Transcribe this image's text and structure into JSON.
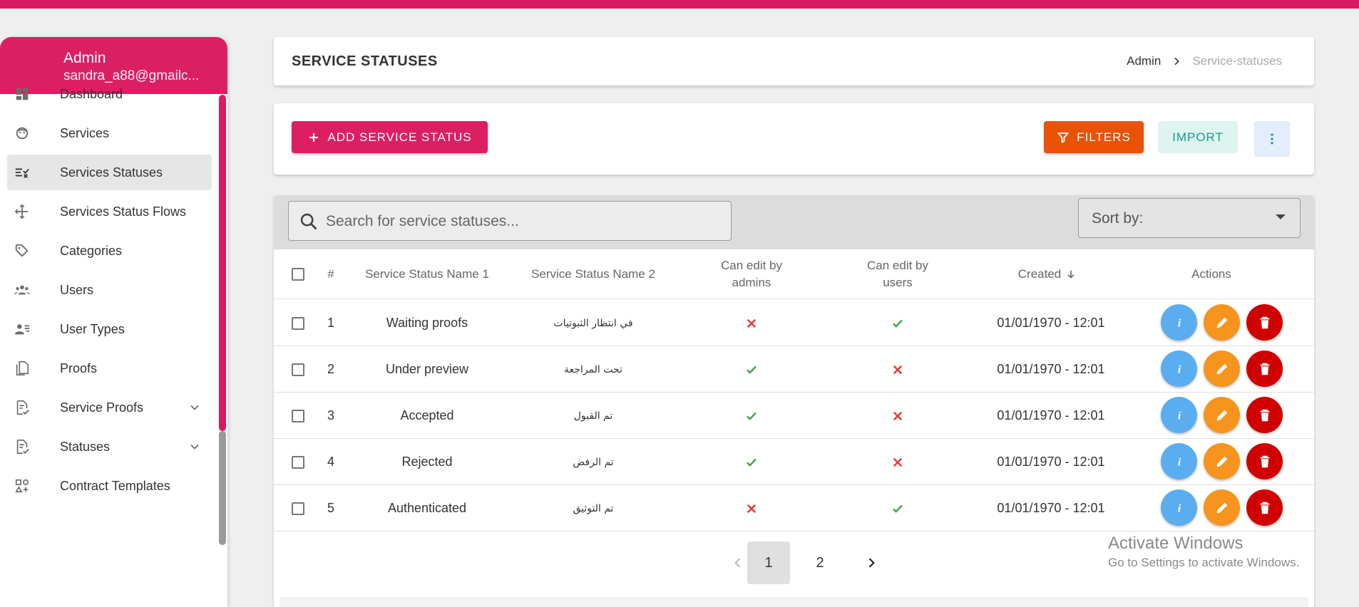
{
  "user": {
    "name": "Admin",
    "email": "sandra_a88@gmailc..."
  },
  "sidebar": {
    "items": [
      {
        "label": "Dashboard",
        "icon": "dashboard-icon",
        "active": false
      },
      {
        "label": "Services",
        "icon": "services-icon",
        "active": false
      },
      {
        "label": "Services Statuses",
        "icon": "checklist-icon",
        "active": true
      },
      {
        "label": "Services Status Flows",
        "icon": "flow-icon",
        "active": false
      },
      {
        "label": "Categories",
        "icon": "tags-icon",
        "active": false
      },
      {
        "label": "Users",
        "icon": "users-icon",
        "active": false
      },
      {
        "label": "User Types",
        "icon": "user-types-icon",
        "active": false
      },
      {
        "label": "Proofs",
        "icon": "proofs-icon",
        "active": false
      },
      {
        "label": "Service Proofs",
        "icon": "document-check-icon",
        "active": false,
        "expandable": true
      },
      {
        "label": "Statuses",
        "icon": "document-check-icon",
        "active": false,
        "expandable": true
      },
      {
        "label": "Contract Templates",
        "icon": "templates-icon",
        "active": false
      }
    ]
  },
  "header": {
    "title": "SERVICE STATUSES",
    "breadcrumb": [
      "Admin",
      "Service-statuses"
    ]
  },
  "toolbar": {
    "add_label": "ADD SERVICE STATUS",
    "filters_label": "FILTERS",
    "import_label": "IMPORT"
  },
  "search": {
    "placeholder": "Search for service statuses..."
  },
  "sort": {
    "label": "Sort by:"
  },
  "table": {
    "columns": {
      "index": "#",
      "name1": "Service Status Name 1",
      "name2": "Service Status Name 2",
      "admins": "Can edit by admins",
      "users": "Can edit by users",
      "created": "Created",
      "actions": "Actions"
    },
    "rows": [
      {
        "id": "1",
        "name1": "Waiting proofs",
        "name2": "في انتظار الثبوتيات",
        "admins": false,
        "users": true,
        "created": "01/01/1970 - 12:01"
      },
      {
        "id": "2",
        "name1": "Under preview",
        "name2": "تحت المراجعة",
        "admins": true,
        "users": false,
        "created": "01/01/1970 - 12:01"
      },
      {
        "id": "3",
        "name1": "Accepted",
        "name2": "تم القبول",
        "admins": true,
        "users": false,
        "created": "01/01/1970 - 12:01"
      },
      {
        "id": "4",
        "name1": "Rejected",
        "name2": "تم الرفض",
        "admins": true,
        "users": false,
        "created": "01/01/1970 - 12:01"
      },
      {
        "id": "5",
        "name1": "Authenticated",
        "name2": "تم التوثيق",
        "admins": false,
        "users": true,
        "created": "01/01/1970 - 12:01"
      }
    ]
  },
  "pagination": {
    "pages": [
      "1",
      "2"
    ],
    "current": "1"
  },
  "watermark": {
    "line1": "Activate Windows",
    "line2": "Go to Settings to activate Windows."
  },
  "colors": {
    "brand": "#dc1f63",
    "filters": "#ea5207",
    "info": "#5aaef0",
    "edit": "#f7941d",
    "delete": "#d00000",
    "check": "#43a047",
    "cross": "#e53935"
  }
}
